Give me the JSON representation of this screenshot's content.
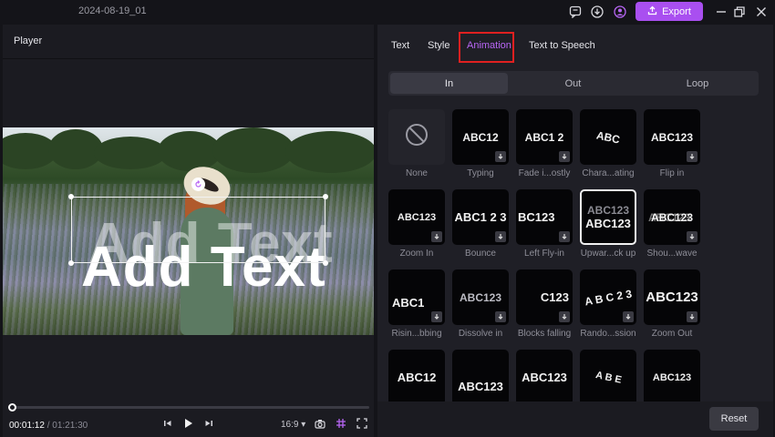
{
  "titlebar": {
    "project_name": "2024-08-19_01",
    "export_label": "Export"
  },
  "player": {
    "title": "Player",
    "overlay_text": "Add Text",
    "current_time": "00:01:12",
    "separator": " / ",
    "total_time": "01:21:30",
    "aspect_ratio": "16:9",
    "progress_fraction": 0.015
  },
  "panel": {
    "tabs": [
      {
        "label": "Text"
      },
      {
        "label": "Style"
      },
      {
        "label": "Animation"
      },
      {
        "label": "Text to Speech"
      }
    ],
    "active_tab": "Animation",
    "segments": [
      {
        "label": "In"
      },
      {
        "label": "Out"
      },
      {
        "label": "Loop"
      }
    ],
    "active_segment": "In",
    "animations": [
      {
        "label": "None",
        "thumb": ""
      },
      {
        "label": "Typing",
        "thumb": "ABC12"
      },
      {
        "label": "Fade i...ostly",
        "thumb": "ABC1 2"
      },
      {
        "label": "Chara...ating",
        "thumb": "ABC"
      },
      {
        "label": "Flip in",
        "thumb": "ABC123"
      },
      {
        "label": "Zoom In",
        "thumb": "ABC123"
      },
      {
        "label": "Bounce",
        "thumb": "ABC1 2 3"
      },
      {
        "label": "Left Fly-in",
        "thumb": "BC123"
      },
      {
        "label": "Upwar...ck up",
        "thumb": "ABC123"
      },
      {
        "label": "Shou...wave",
        "thumb": "ABC123"
      },
      {
        "label": "Risin...bbing",
        "thumb": "ABC1"
      },
      {
        "label": "Dissolve in",
        "thumb": "ABC123"
      },
      {
        "label": "Blocks falling",
        "thumb": "C123"
      },
      {
        "label": "Rando...ssion",
        "thumb": "A B C 2 3"
      },
      {
        "label": "Zoom Out",
        "thumb": "ABC123"
      },
      {
        "label": "",
        "thumb": "ABC12"
      },
      {
        "label": "",
        "thumb": "ABC123"
      },
      {
        "label": "",
        "thumb": "ABC123"
      },
      {
        "label": "",
        "thumb": "A B E"
      },
      {
        "label": "",
        "thumb": "ABC123"
      }
    ],
    "selected_animation": "Upwar...ck up",
    "reset_label": "Reset"
  },
  "colors": {
    "accent": "#a94ff0",
    "active_tab": "#b866f5",
    "highlight_box": "#e02020"
  },
  "icons": [
    "message-icon",
    "download-icon",
    "account-icon",
    "upload-icon",
    "minimize-icon",
    "restore-icon",
    "close-icon",
    "prev-frame-icon",
    "play-icon",
    "next-frame-icon",
    "camera-icon",
    "grid-icon",
    "fullscreen-icon",
    "none-icon",
    "download-arrow-icon",
    "rotate-icon"
  ]
}
